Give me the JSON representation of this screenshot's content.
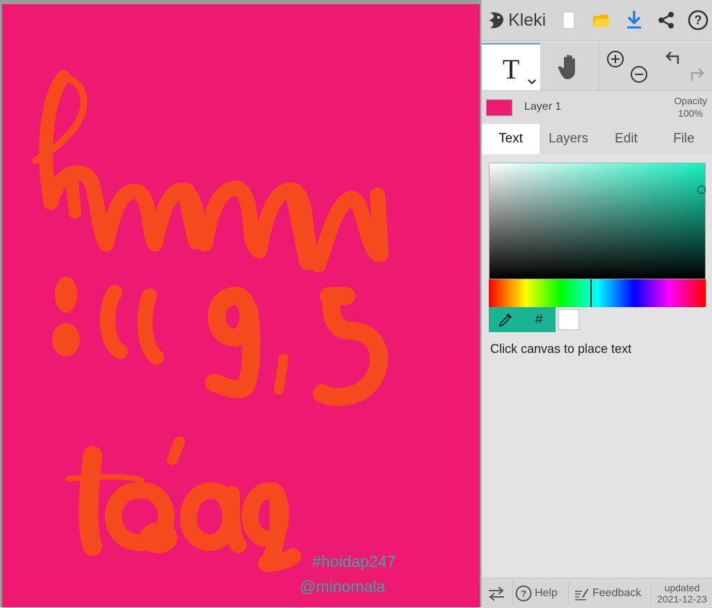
{
  "app": {
    "name": "Kleki"
  },
  "toolbar": {
    "icons": [
      "new-image-icon",
      "open-folder-icon",
      "download-icon",
      "share-icon",
      "help-icon"
    ],
    "tools": [
      "text-tool",
      "hand-tool",
      "zoom-in",
      "zoom-out",
      "undo",
      "redo"
    ]
  },
  "layer": {
    "name": "Layer 1",
    "opacity_label": "Opacity",
    "opacity_value": "100%"
  },
  "tabs": [
    {
      "label": "Text",
      "active": true
    },
    {
      "label": "Layers",
      "active": false
    },
    {
      "label": "Edit",
      "active": false
    },
    {
      "label": "File",
      "active": false
    }
  ],
  "color": {
    "current": "#ffffff",
    "hue": "#18f0c0",
    "hex_symbol": "#",
    "accent": "#1ab394"
  },
  "hint": "Click canvas to place text",
  "canvas": {
    "background": "#ee1a72",
    "stroke": "#f44a1e",
    "watermark_tag": "#hoidap247",
    "watermark_user": "@minomala"
  },
  "footer": {
    "help": "Help",
    "feedback": "Feedback",
    "updated_label": "updated",
    "updated_date": "2021-12-23"
  }
}
